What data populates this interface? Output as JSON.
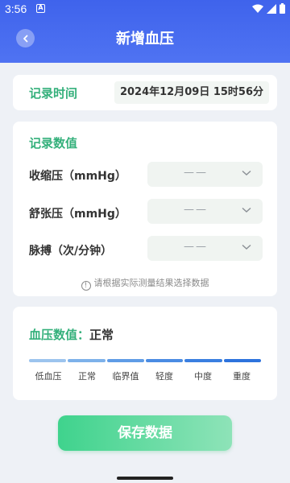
{
  "status": {
    "time": "3:56",
    "app_icon": "A"
  },
  "header": {
    "title": "新增血压",
    "back_icon": "back-icon"
  },
  "record_time": {
    "label": "记录时间",
    "value": "2024年12月09日 15时56分"
  },
  "values": {
    "title": "记录数值",
    "rows": [
      {
        "label": "收缩压（mmHg）",
        "value": "——"
      },
      {
        "label": "舒张压（mmHg）",
        "value": "——"
      },
      {
        "label": "脉搏（次/分钟）",
        "value": "——"
      }
    ],
    "hint": "请根据实际测量结果选择数据"
  },
  "bp_status": {
    "label": "血压数值：",
    "value": "正常",
    "levels": [
      "低血压",
      "正常",
      "临界值",
      "轻度",
      "中度",
      "重度"
    ],
    "colors": [
      "#9cc4ee",
      "#7db1ea",
      "#5f9ce6",
      "#4a8ce3",
      "#3a7fe0",
      "#2d73dd"
    ]
  },
  "save_label": "保存数据",
  "colors": {
    "primary": "#4f73f2",
    "accent_green": "#34b07b"
  }
}
